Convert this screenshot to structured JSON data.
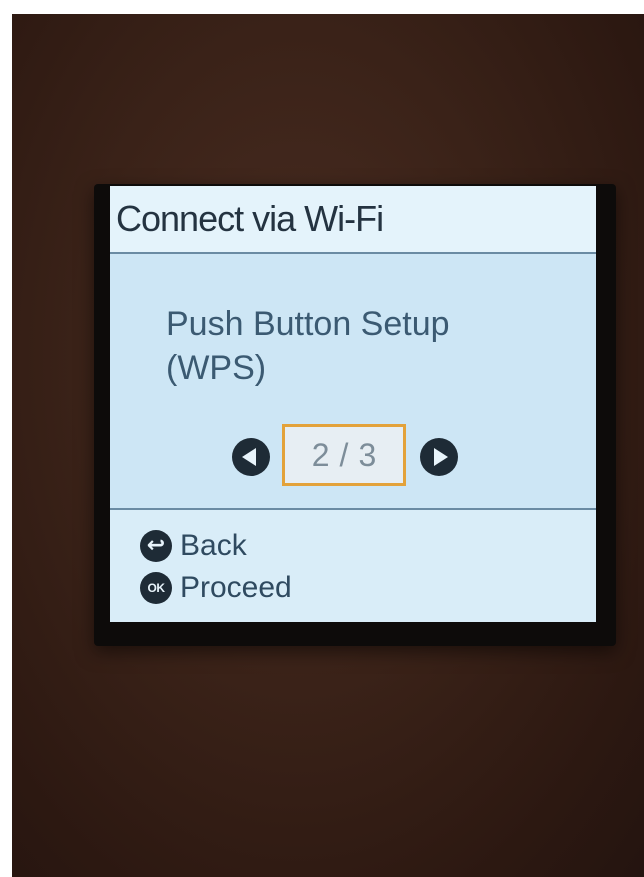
{
  "screen": {
    "title": "Connect via Wi-Fi",
    "option": {
      "label_line1": "Push Button Setup",
      "label_line2": "(WPS)"
    },
    "pager": {
      "current": "2",
      "separator": "/",
      "total": "3"
    },
    "footer": {
      "back_icon": "back-icon",
      "back_label": "Back",
      "ok_icon_text": "OK",
      "proceed_label": "Proceed"
    }
  },
  "colors": {
    "screen_bg": "#cde6f5",
    "title_bg": "#e4f3fb",
    "text": "#3b5a72",
    "highlight": "#e3a23a",
    "bezel": "#0d0b0a",
    "surround": "#3a2218"
  }
}
